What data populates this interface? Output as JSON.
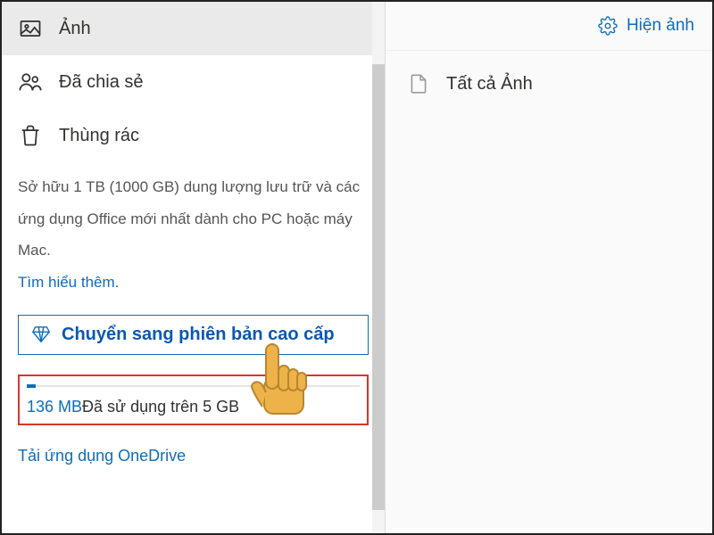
{
  "sidebar": {
    "nav": [
      {
        "label": "Ảnh"
      },
      {
        "label": "Đã chia sẻ"
      },
      {
        "label": "Thùng rác"
      }
    ],
    "promo": {
      "text": "Sở hữu 1 TB (1000 GB) dung lượng lưu trữ và các ứng dụng Office mới nhất dành cho PC hoặc máy Mac.",
      "learn_more": "Tìm hiểu thêm."
    },
    "upgrade_label": "Chuyển sang phiên bản cao cấp",
    "storage": {
      "used": "136 MB",
      "rest": "Đã sử dụng trên 5 GB"
    },
    "download_label": "Tải ứng dụng OneDrive"
  },
  "toolbar": {
    "view_label": "Hiện ảnh"
  },
  "content": {
    "item_label": "Tất cả Ảnh"
  }
}
